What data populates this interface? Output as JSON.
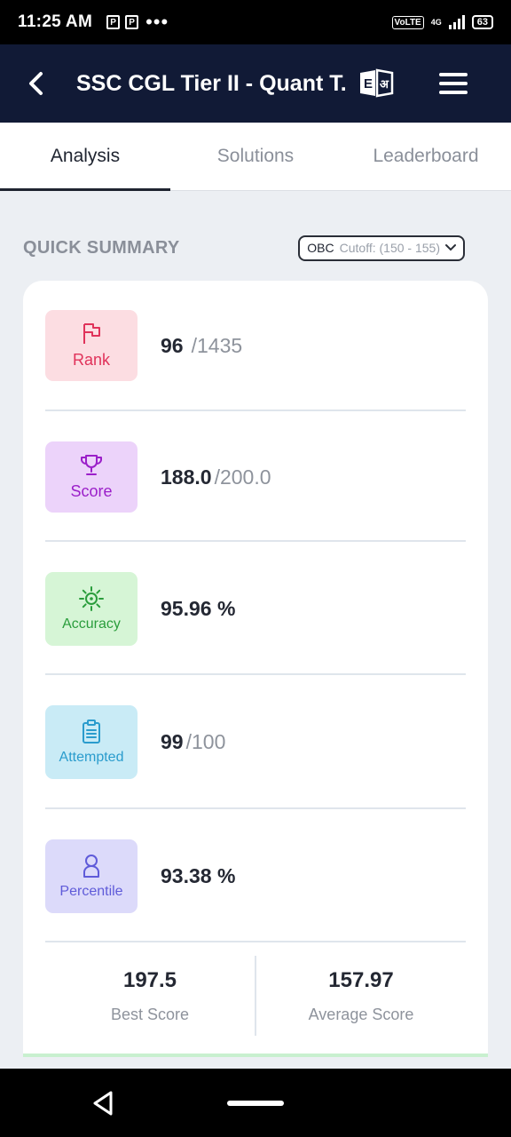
{
  "status_bar": {
    "time": "11:25 AM",
    "icons": [
      "P",
      "P"
    ],
    "network": "VoLTE",
    "network_type": "4G",
    "battery": "63"
  },
  "header": {
    "title": "SSC CGL Tier II - Quant T...",
    "lang_toggle": {
      "left": "E",
      "right": "अ"
    }
  },
  "tabs": [
    {
      "label": "Analysis",
      "active": true
    },
    {
      "label": "Solutions",
      "active": false
    },
    {
      "label": "Leaderboard",
      "active": false
    }
  ],
  "summary": {
    "title": "QUICK SUMMARY",
    "category": "OBC",
    "cutoff": "Cutoff: (150 - 155)",
    "rank": {
      "label": "Rank",
      "value": "96",
      "total": "/1435"
    },
    "score": {
      "label": "Score",
      "value": "188.0",
      "total": "/200.0"
    },
    "accuracy": {
      "label": "Accuracy",
      "value": "95.96 %"
    },
    "attempted": {
      "label": "Attempted",
      "value": "99",
      "total": "/100"
    },
    "percentile": {
      "label": "Percentile",
      "value": "93.38 %"
    },
    "best_score": {
      "value": "197.5",
      "label": "Best Score"
    },
    "average_score": {
      "value": "157.97",
      "label": "Average Score"
    }
  },
  "colors": {
    "rank_bg": "#fcdde2",
    "rank_fg": "#e0325a",
    "score_bg": "#ecd3fa",
    "score_fg": "#9b1fc9",
    "accuracy_bg": "#d6f5d6",
    "accuracy_fg": "#2a9d3c",
    "attempted_bg": "#c9ebf6",
    "attempted_fg": "#2a9ccd",
    "percentile_bg": "#dcdafa",
    "percentile_fg": "#5f5bd9",
    "appbar": "#111a36"
  }
}
